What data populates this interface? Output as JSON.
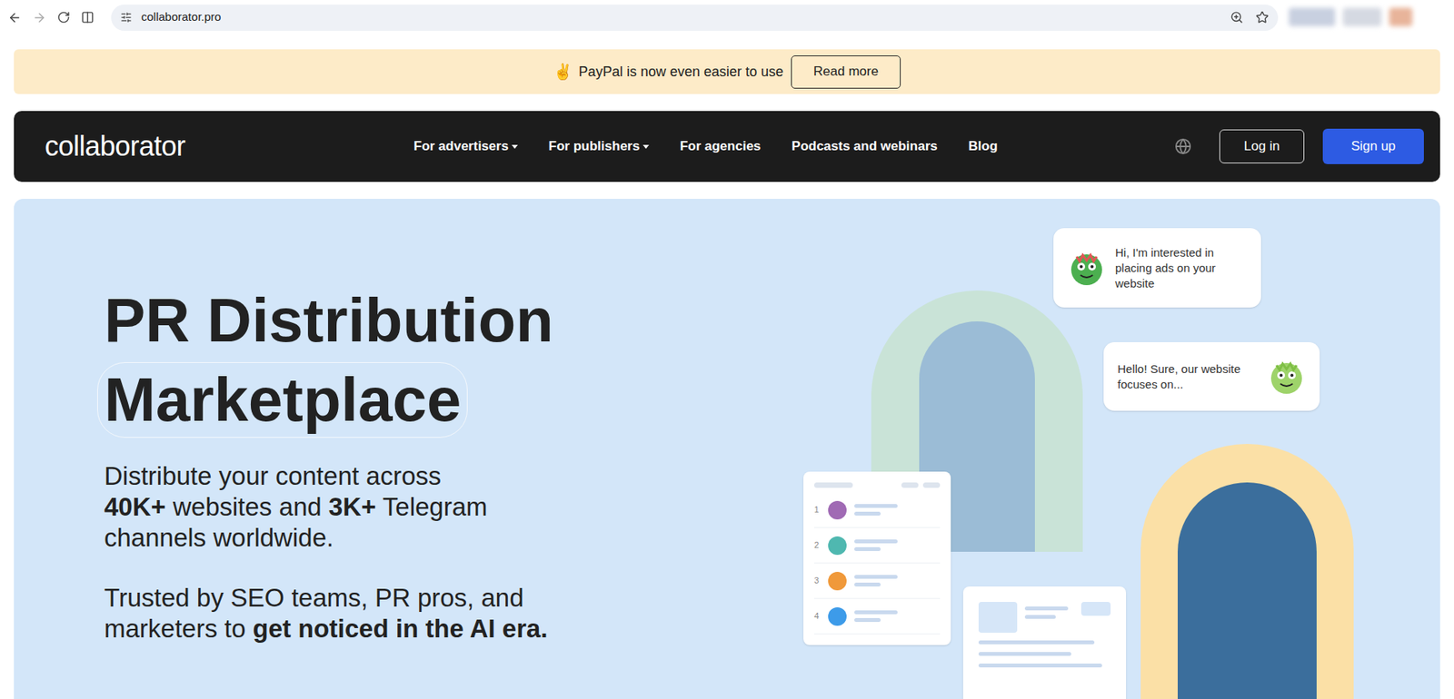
{
  "browser": {
    "url": "collaborator.pro"
  },
  "banner": {
    "emoji": "✌️",
    "text": "PayPal is now even easier to use",
    "button": "Read more"
  },
  "nav": {
    "logo": "collaborator",
    "links": [
      {
        "label": "For advertisers",
        "dropdown": true
      },
      {
        "label": "For publishers",
        "dropdown": true
      },
      {
        "label": "For agencies",
        "dropdown": false
      },
      {
        "label": "Podcasts and webinars",
        "dropdown": false
      },
      {
        "label": "Blog",
        "dropdown": false
      }
    ],
    "login": "Log in",
    "signup": "Sign up"
  },
  "hero": {
    "title_lines": [
      "PR Distribution",
      "Marketplace"
    ],
    "subtitle_lines": [
      [
        {
          "text": "Distribute your content across",
          "bold": false
        }
      ],
      [
        {
          "text": "40K+",
          "bold": true
        },
        {
          "text": " websites and ",
          "bold": false
        },
        {
          "text": "3K+",
          "bold": true
        },
        {
          "text": " Telegram",
          "bold": false
        }
      ],
      [
        {
          "text": "channels worldwide.",
          "bold": false
        }
      ]
    ],
    "trust_lines": [
      [
        {
          "text": "Trusted by SEO teams, PR pros, and",
          "bold": false
        }
      ],
      [
        {
          "text": "marketers to ",
          "bold": false
        },
        {
          "text": "get noticed in the AI era.",
          "bold": true
        }
      ]
    ]
  },
  "illustration": {
    "bubbles": [
      {
        "text": "Hi, I'm interested in placing ads on your website",
        "avatar_side": "left"
      },
      {
        "text": "Hello! Sure, our website focuses on...",
        "avatar_side": "right"
      }
    ],
    "list": [
      {
        "number": "1",
        "color": "#a06ab4"
      },
      {
        "number": "2",
        "color": "#4fb8b0"
      },
      {
        "number": "3",
        "color": "#f0993a"
      },
      {
        "number": "4",
        "color": "#3d9be9"
      }
    ]
  }
}
